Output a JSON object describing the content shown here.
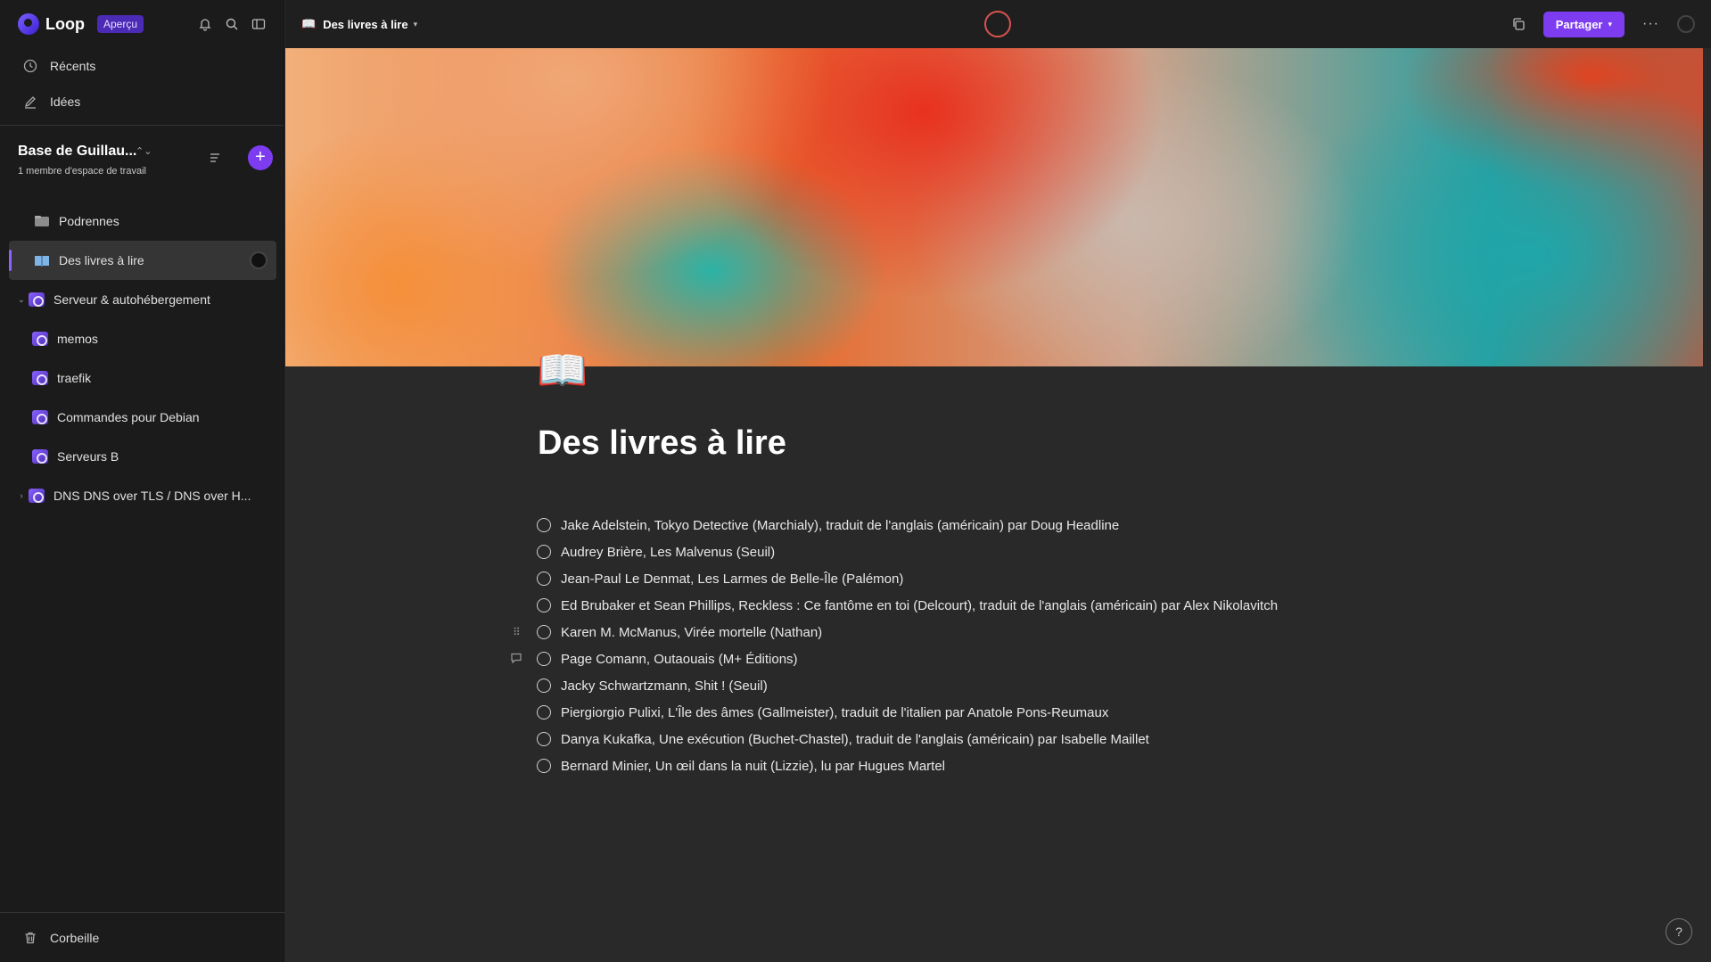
{
  "app": {
    "name": "Loop",
    "badge": "Aperçu"
  },
  "sidebar": {
    "nav": [
      {
        "label": "Récents",
        "icon": "clock-icon"
      },
      {
        "label": "Idées",
        "icon": "pen-icon"
      }
    ],
    "workspace": {
      "title": "Base de Guillau...",
      "subtitle": "1 membre d'espace de travail"
    },
    "tree": [
      {
        "label": "Podrennes",
        "icon": "folder-icon",
        "level": 0
      },
      {
        "label": "Des livres à lire",
        "icon": "book-icon",
        "level": 0,
        "active": true
      },
      {
        "label": "Serveur & autohébergement",
        "icon": "loop-page-icon",
        "level": 0,
        "expanded": true
      },
      {
        "label": "memos",
        "icon": "loop-page-icon",
        "level": 1
      },
      {
        "label": "traefik",
        "icon": "loop-page-icon",
        "level": 1
      },
      {
        "label": "Commandes pour Debian",
        "icon": "loop-page-icon",
        "level": 1
      },
      {
        "label": "Serveurs B",
        "icon": "loop-page-icon",
        "level": 1
      },
      {
        "label": "DNS DNS over TLS / DNS over H...",
        "icon": "loop-page-icon",
        "level": 0,
        "expanded": false
      }
    ],
    "trash": "Corbeille"
  },
  "topbar": {
    "breadcrumb": "Des livres à lire",
    "share": "Partager"
  },
  "page": {
    "emoji": "📖",
    "title": "Des livres à lire",
    "items": [
      "Jake Adelstein, Tokyo Detective (Marchialy), traduit de l'anglais (américain) par Doug Headline",
      "Audrey Brière, Les Malvenus (Seuil)",
      "Jean-Paul Le Denmat, Les Larmes de Belle-Île (Palémon)",
      "Ed Brubaker et Sean Phillips, Reckless : Ce fantôme en toi (Delcourt), traduit de l'anglais (américain) par Alex Nikolavitch",
      "Karen M. McManus, Virée mortelle (Nathan)",
      "Page Comann, Outaouais (M+ Éditions)",
      "Jacky Schwartzmann, Shit ! (Seuil)",
      "Piergiorgio Pulixi, L'Île des âmes (Gallmeister), traduit de l'italien par Anatole Pons-Reumaux",
      "Danya Kukafka, Une exécution (Buchet-Chastel), traduit de l'anglais (américain) par Isabelle Maillet",
      "Bernard Minier, Un œil dans la nuit (Lizzie), lu par Hugues Martel"
    ]
  },
  "help": "?",
  "colors": {
    "accent": "#7d3cf0",
    "sidebar_bg": "#1b1b1b",
    "page_bg": "#292929"
  }
}
